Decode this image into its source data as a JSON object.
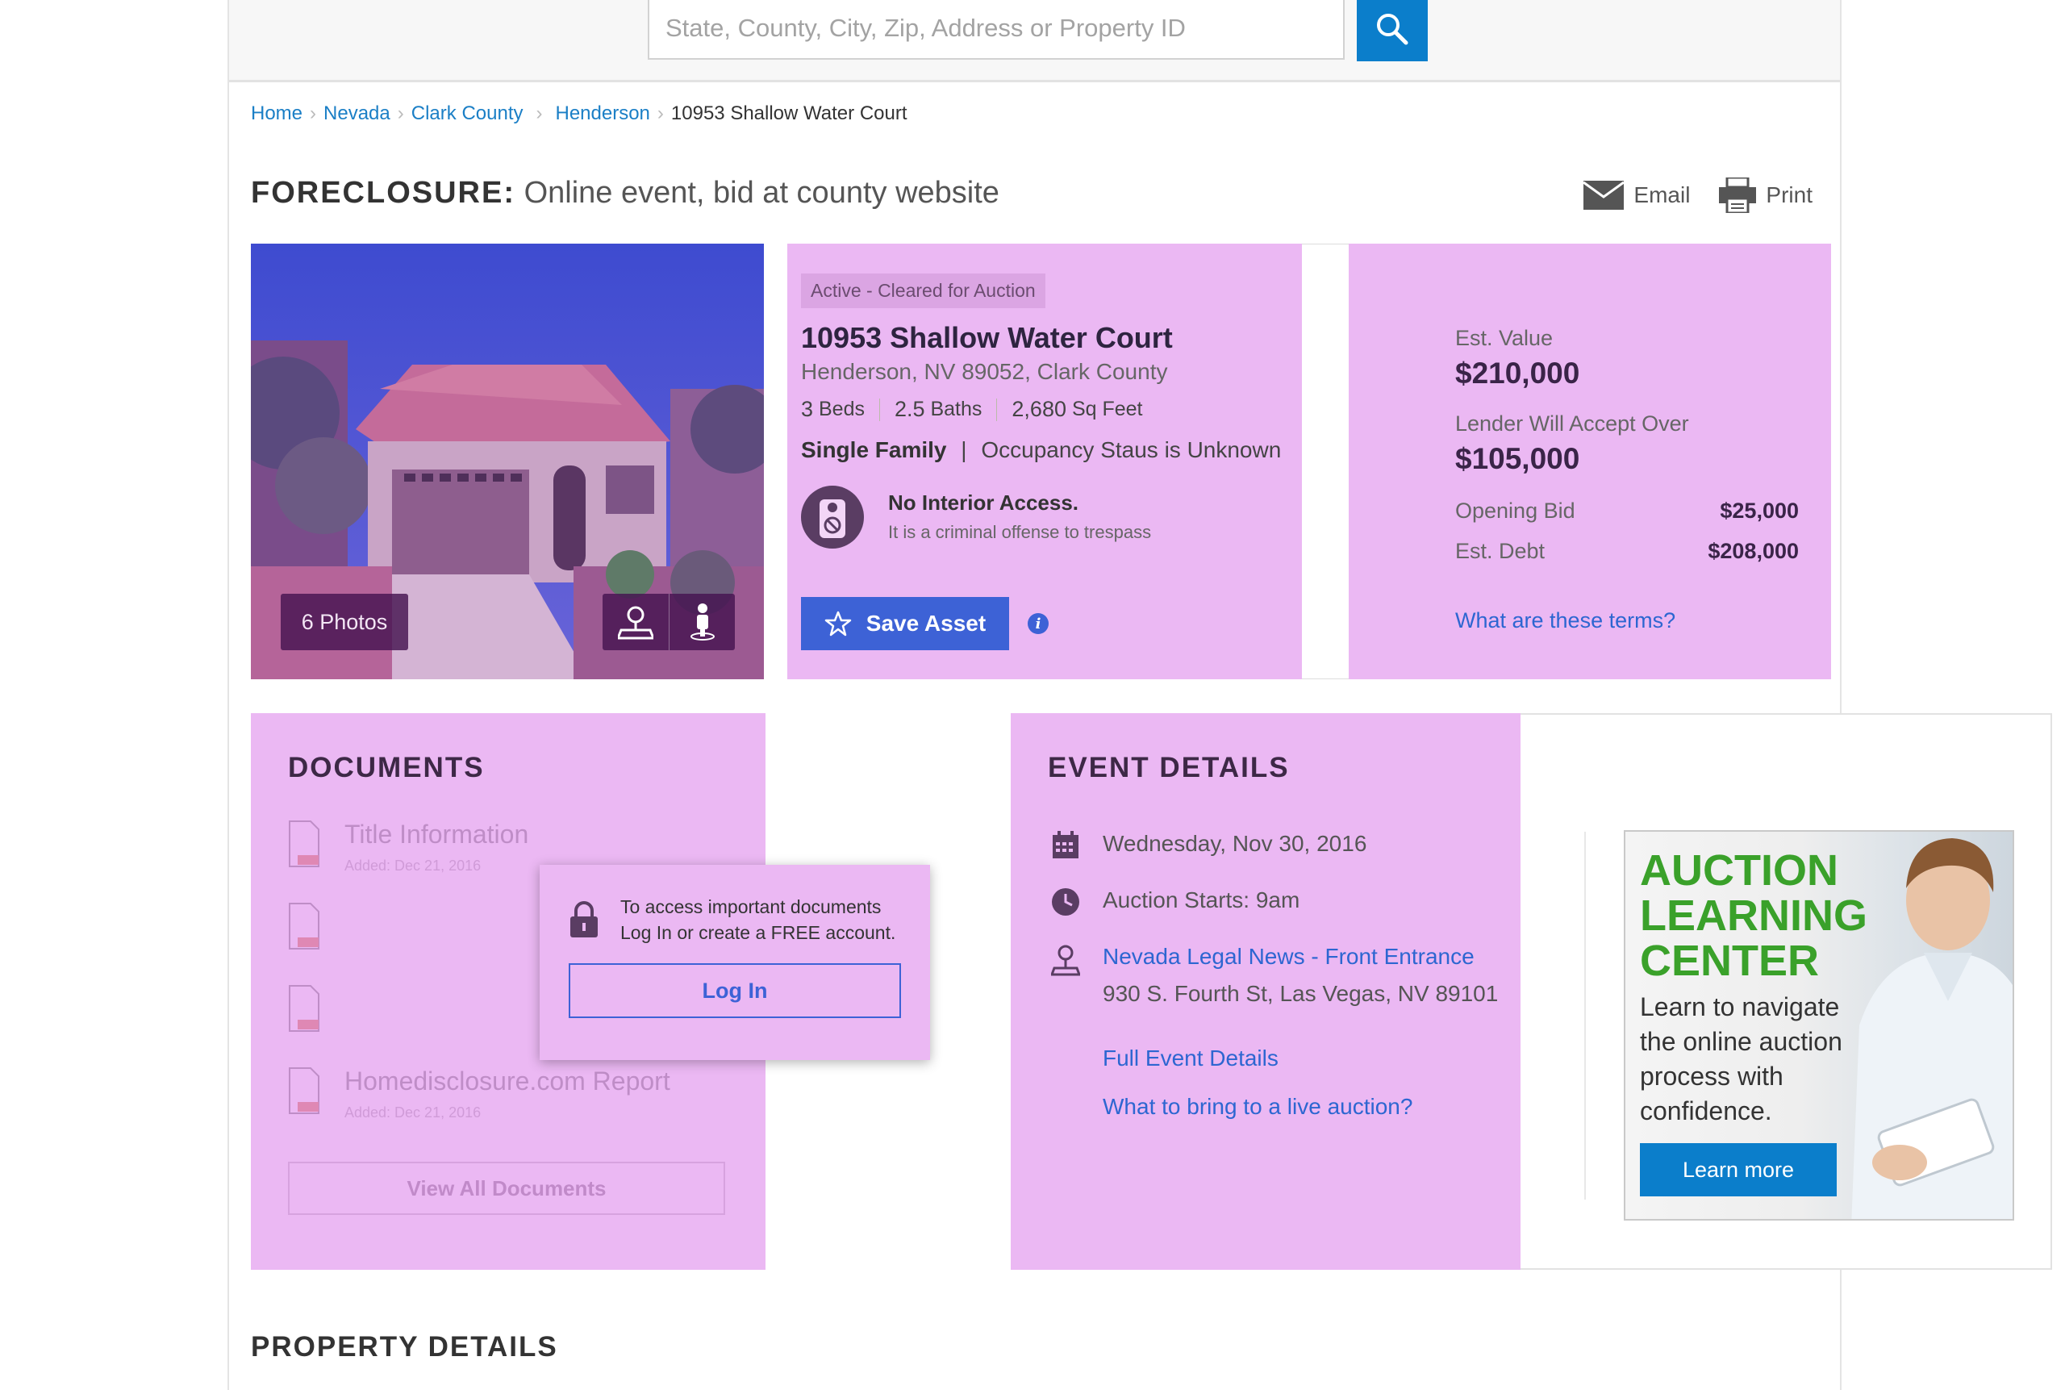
{
  "search": {
    "placeholder": "State, County, City, Zip, Address or Property ID"
  },
  "breadcrumb": {
    "items": [
      "Home",
      "Nevada",
      "Clark County",
      "Henderson"
    ],
    "current": "10953 Shallow Water Court"
  },
  "headline": {
    "label": "FORECLOSURE:",
    "text": "Online event, bid at county website"
  },
  "actions": {
    "email": "Email",
    "print": "Print"
  },
  "photo": {
    "photos_label": "6 Photos"
  },
  "property": {
    "status": "Active - Cleared for Auction",
    "title": "10953 Shallow Water Court",
    "subtitle": "Henderson, NV 89052, Clark County",
    "beds_num": "3",
    "beds_label": "Beds",
    "baths_num": "2.5",
    "baths_label": "Baths",
    "sqft_num": "2,680",
    "sqft_label": "Sq Feet",
    "type": "Single Family",
    "occupancy": "Occupancy Staus is Unknown",
    "access_title": "No Interior Access.",
    "access_sub": "It is a criminal offense to trespass",
    "save_label": "Save Asset"
  },
  "values": {
    "est_value_label": "Est. Value",
    "est_value": "$210,000",
    "lender_label": "Lender Will Accept Over",
    "lender_value": "$105,000",
    "opening_label": "Opening Bid",
    "opening_value": "$25,000",
    "debt_label": "Est. Debt",
    "debt_value": "$208,000",
    "terms_link": "What are these terms?"
  },
  "documents": {
    "title": "DOCUMENTS",
    "items": [
      {
        "name": "Title Information",
        "date": "Added: Dec 21, 2016"
      },
      {
        "name": "Homedisclosure.com Report",
        "date": "Added: Dec 21, 2016"
      }
    ],
    "view_all": "View All Documents",
    "popup_line1": "To access important documents",
    "popup_line2": "Log In or create a FREE account.",
    "login": "Log In"
  },
  "event": {
    "title": "EVENT DETAILS",
    "date": "Wednesday, Nov 30, 2016",
    "start": "Auction Starts:  9am",
    "venue": "Nevada Legal News - Front Entrance",
    "address": "930 S. Fourth St, Las Vegas, NV 89101",
    "full_details": "Full Event Details",
    "bring": "What to bring to a live auction?"
  },
  "ad": {
    "headline": "AUCTION\nLEARNING\nCENTER",
    "text": "Learn to navigate the online auction process with confidence.",
    "button": "Learn more"
  },
  "property_details_title": "PROPERTY DETAILS",
  "colors": {
    "accent_blue": "#0b7ecb",
    "highlight_pink": "#ebb8f3",
    "save_blue": "#3d62d6"
  }
}
